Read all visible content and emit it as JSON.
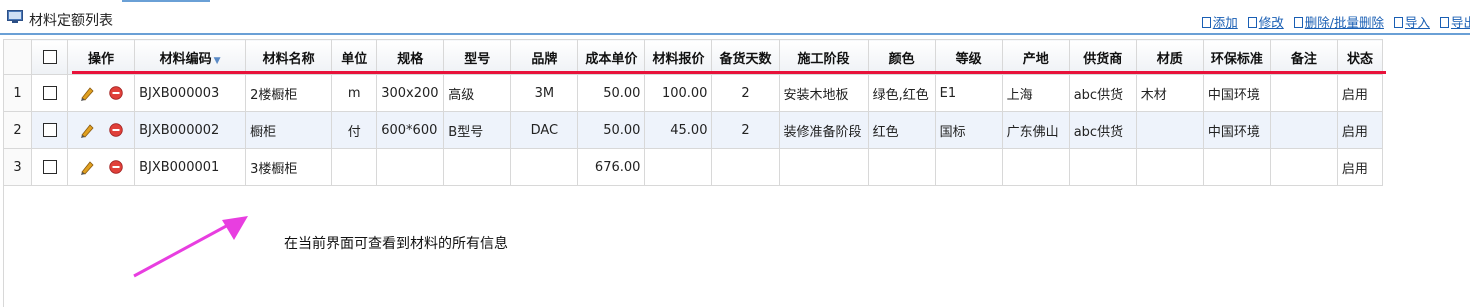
{
  "panel": {
    "title": "材料定额列表",
    "title_icon": "monitor-icon"
  },
  "toolbar": [
    {
      "name": "add-button",
      "label": "添加"
    },
    {
      "name": "edit-button",
      "label": "修改"
    },
    {
      "name": "delete-button",
      "label": "删除/批量删除"
    },
    {
      "name": "import-button",
      "label": "导入"
    },
    {
      "name": "export-button",
      "label": "导出"
    }
  ],
  "table": {
    "headers": [
      "操作",
      "材料编码",
      "材料名称",
      "单位",
      "规格",
      "型号",
      "品牌",
      "成本单价",
      "材料报价",
      "备货天数",
      "施工阶段",
      "颜色",
      "等级",
      "产地",
      "供货商",
      "材质",
      "环保标准",
      "备注",
      "状态"
    ],
    "sorted_column": "材料编码",
    "rows": [
      {
        "num": "1",
        "code": "BJXB000003",
        "name": "2楼橱柜",
        "unit": "m",
        "spec": "300x200",
        "model": "高级",
        "brand": "3M",
        "cost": "50.00",
        "quote": "100.00",
        "days": "2",
        "stage": "安装木地板",
        "color": "绿色,红色",
        "grade": "E1",
        "origin": "上海",
        "supplier": "abc供货",
        "material": "木材",
        "eco": "中国环境",
        "remark": "",
        "status": "启用"
      },
      {
        "num": "2",
        "code": "BJXB000002",
        "name": "橱柜",
        "unit": "付",
        "spec": "600*600",
        "model": "B型号",
        "brand": "DAC",
        "cost": "50.00",
        "quote": "45.00",
        "days": "2",
        "stage": "装修准备阶段",
        "color": "红色",
        "grade": "国标",
        "origin": "广东佛山",
        "supplier": "abc供货",
        "material": "",
        "eco": "中国环境",
        "remark": "",
        "status": "启用"
      },
      {
        "num": "3",
        "code": "BJXB000001",
        "name": "3楼橱柜",
        "unit": "",
        "spec": "",
        "model": "",
        "brand": "",
        "cost": "676.00",
        "quote": "",
        "days": "",
        "stage": "",
        "color": "",
        "grade": "",
        "origin": "",
        "supplier": "",
        "material": "",
        "eco": "",
        "remark": "",
        "status": "启用"
      }
    ]
  },
  "annotation": {
    "text": "在当前界面可查看到材料的所有信息",
    "arrow_color": "#e83ee0",
    "underline_color": "#e8123a"
  }
}
